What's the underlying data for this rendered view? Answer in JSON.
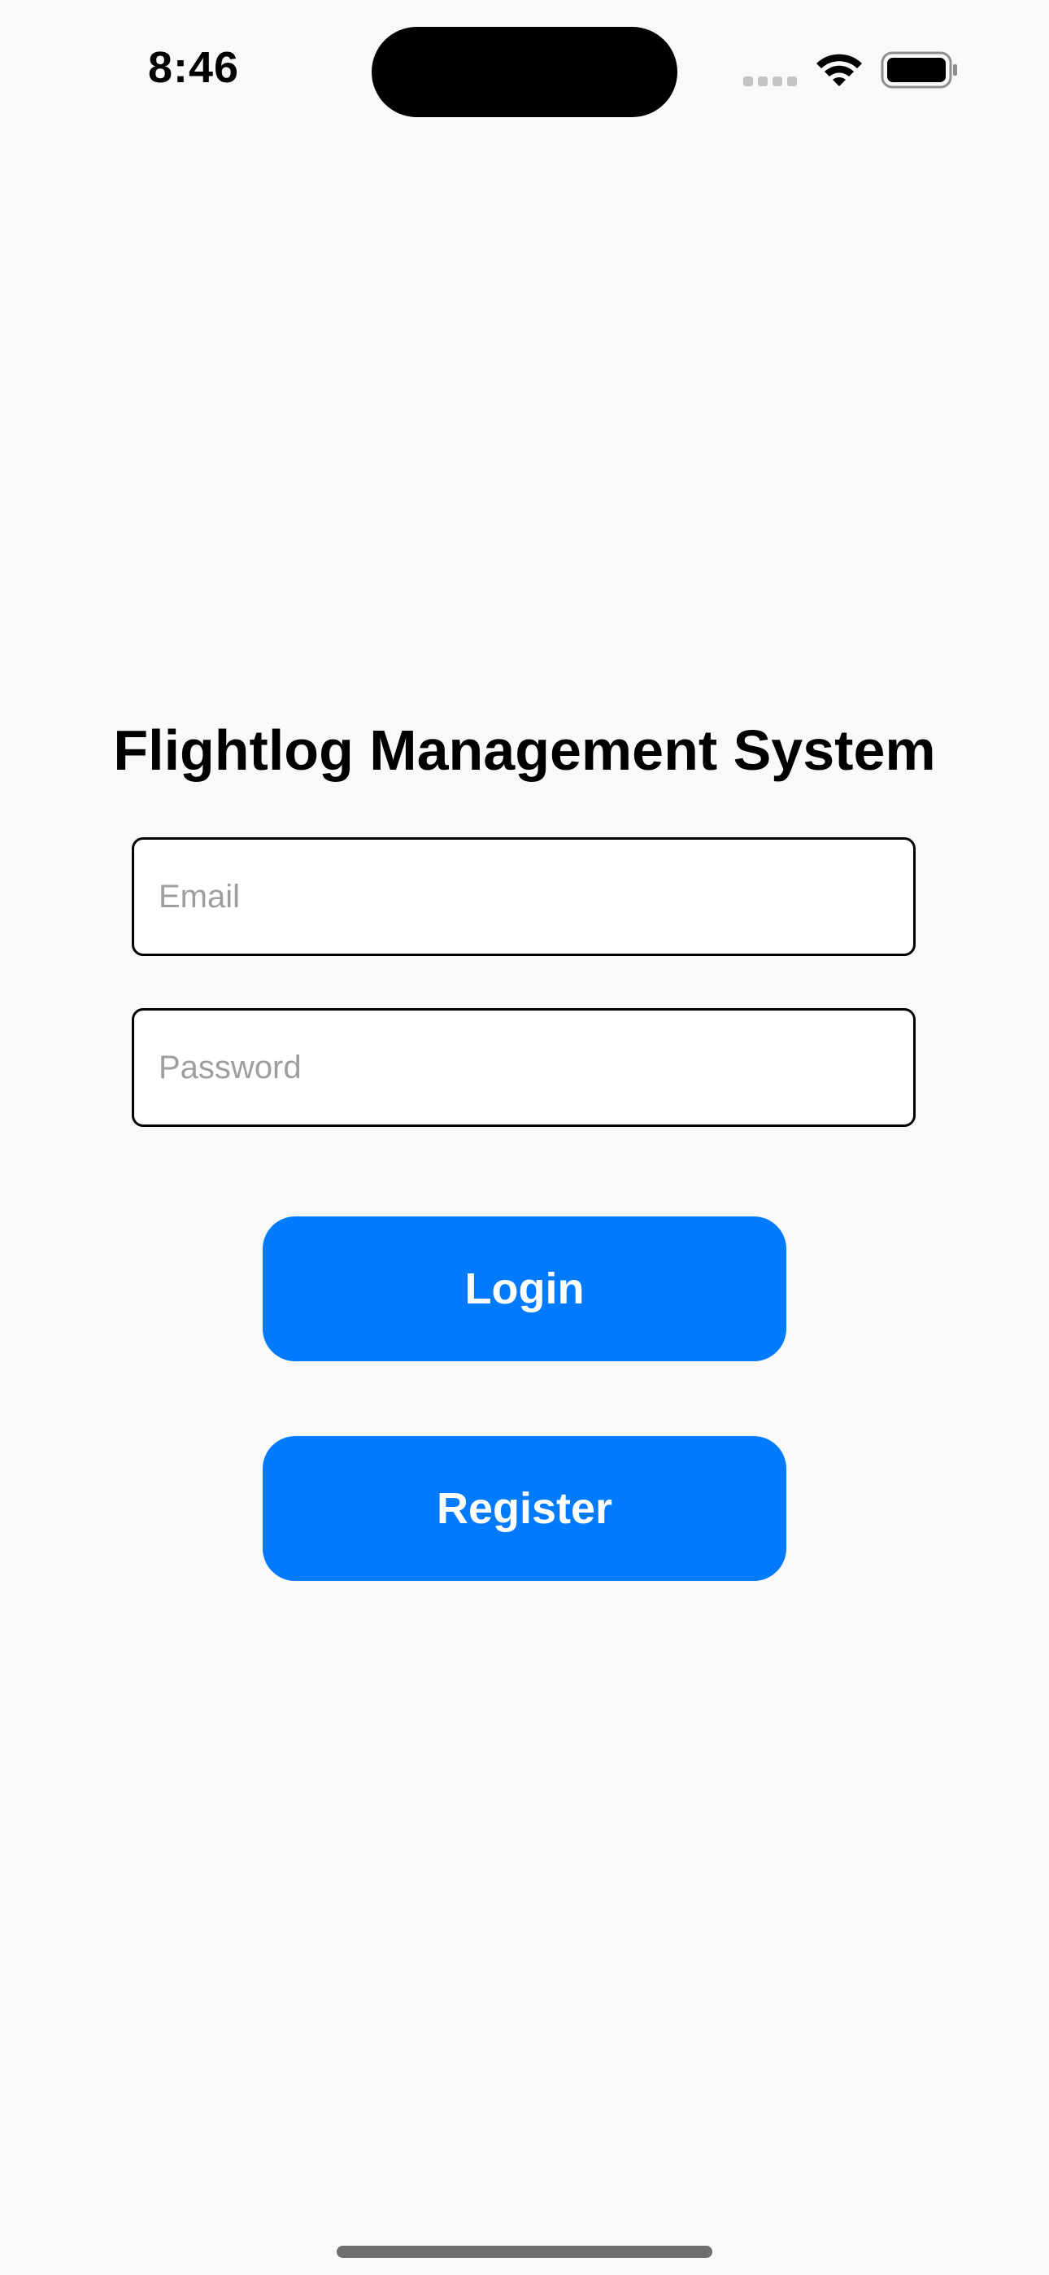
{
  "status_bar": {
    "time": "8:46",
    "icons": [
      "signal-icon",
      "wifi-icon",
      "battery-icon"
    ]
  },
  "login": {
    "title": "Flightlog Management System",
    "email_placeholder": "Email",
    "email_value": "",
    "password_placeholder": "Password",
    "password_value": "",
    "login_label": "Login",
    "register_label": "Register"
  },
  "colors": {
    "background": "#f9f9f9",
    "accent": "#007aff",
    "button_text": "#ffffff",
    "placeholder": "#9e9e9e"
  }
}
